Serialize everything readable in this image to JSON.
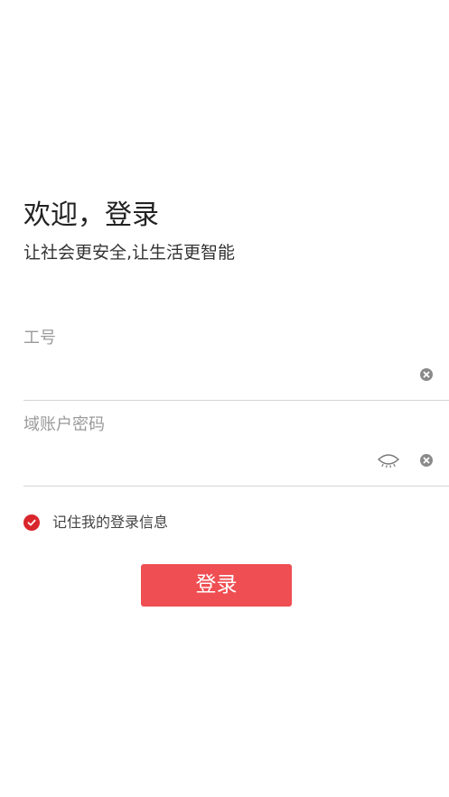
{
  "welcome": {
    "title": "欢迎，登录",
    "subtitle": "让社会更安全,让生活更智能"
  },
  "form": {
    "employee_id": {
      "label": "工号",
      "value": ""
    },
    "password": {
      "label": "域账户密码",
      "value": ""
    },
    "remember": {
      "label": "记住我的登录信息",
      "checked": true
    },
    "login_label": "登录"
  },
  "icons": {
    "clear": "clear-icon",
    "eye": "eye-closed-icon",
    "check": "check-icon"
  },
  "colors": {
    "accent": "#ef4e52",
    "checkbox": "#d9262c",
    "label": "#9a9a9a",
    "divider": "#d4d4d4"
  }
}
